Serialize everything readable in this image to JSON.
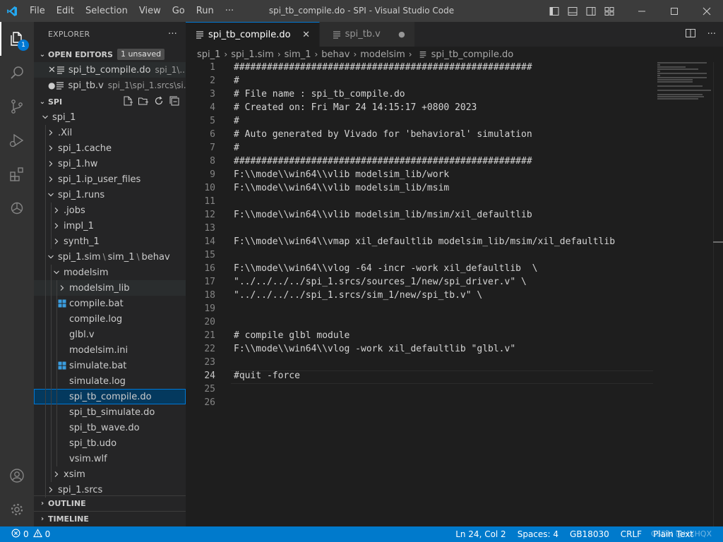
{
  "window": {
    "title": "spi_tb_compile.do - SPI - Visual Studio Code"
  },
  "menu": [
    "File",
    "Edit",
    "Selection",
    "View",
    "Go",
    "Run",
    "···"
  ],
  "activity": {
    "explorer_badge": "1"
  },
  "sidebar": {
    "title": "EXPLORER",
    "more": "···",
    "open_editors": {
      "label": "OPEN EDITORS",
      "badge": "1 unsaved",
      "items": [
        {
          "name": "spi_tb_compile.do",
          "desc": "spi_1\\..."
        },
        {
          "name": "spi_tb.v",
          "desc": "spi_1\\spi_1.srcs\\si..."
        }
      ]
    },
    "folder": {
      "label": "SPI",
      "tree": [
        "spi_1",
        ".Xil",
        "spi_1.cache",
        "spi_1.hw",
        "spi_1.ip_user_files",
        "spi_1.runs",
        ".jobs",
        "impl_1",
        "synth_1",
        "spi_1.sim",
        "sim_1",
        "behav",
        "modelsim",
        "modelsim_lib",
        "compile.bat",
        "compile.log",
        "glbl.v",
        "modelsim.ini",
        "simulate.bat",
        "simulate.log",
        "spi_tb_compile.do",
        "spi_tb_simulate.do",
        "spi_tb_wave.do",
        "spi_tb.udo",
        "vsim.wlf",
        "xsim",
        "spi_1.srcs"
      ]
    },
    "outline": "OUTLINE",
    "timeline": "TIMELINE"
  },
  "tabs": [
    {
      "label": "spi_tb_compile.do",
      "active": true
    },
    {
      "label": "spi_tb.v",
      "active": false
    }
  ],
  "breadcrumbs": [
    "spi_1",
    "spi_1.sim",
    "sim_1",
    "behav",
    "modelsim",
    "spi_tb_compile.do"
  ],
  "code": {
    "current_line": 24,
    "lines": [
      "######################################################",
      "#",
      "# File name : spi_tb_compile.do",
      "# Created on: Fri Mar 24 14:15:17 +0800 2023",
      "#",
      "# Auto generated by Vivado for 'behavioral' simulation",
      "#",
      "######################################################",
      "F:\\\\mode\\\\win64\\\\vlib modelsim_lib/work",
      "F:\\\\mode\\\\win64\\\\vlib modelsim_lib/msim",
      "",
      "F:\\\\mode\\\\win64\\\\vlib modelsim_lib/msim/xil_defaultlib",
      "",
      "F:\\\\mode\\\\win64\\\\vmap xil_defaultlib modelsim_lib/msim/xil_defaultlib",
      "",
      "F:\\\\mode\\\\win64\\\\vlog -64 -incr -work xil_defaultlib  \\",
      "\"../../../../spi_1.srcs/sources_1/new/spi_driver.v\" \\",
      "\"../../../../spi_1.srcs/sim_1/new/spi_tb.v\" \\",
      "",
      "",
      "# compile glbl module",
      "F:\\\\mode\\\\win64\\\\vlog -work xil_defaultlib \"glbl.v\"",
      "",
      "#quit -force",
      "",
      ""
    ]
  },
  "status": {
    "errors": "0",
    "warnings": "0",
    "position": "Ln 24, Col 2",
    "spaces": "Spaces: 4",
    "encoding": "GB18030",
    "eol": "CRLF",
    "language": "Plain Text",
    "watermark": "CSDN @HXHQX"
  },
  "colors": {
    "accent": "#007acc",
    "selection": "#04395e"
  }
}
